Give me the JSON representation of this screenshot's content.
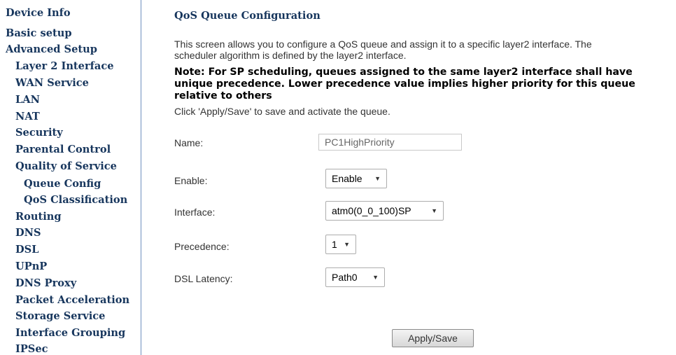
{
  "sidebar": {
    "items": [
      {
        "label": "Device Info"
      },
      {
        "label": "Basic setup"
      },
      {
        "label": "Advanced Setup"
      },
      {
        "label": "Layer 2 Interface"
      },
      {
        "label": "WAN Service"
      },
      {
        "label": "LAN"
      },
      {
        "label": "NAT"
      },
      {
        "label": "Security"
      },
      {
        "label": "Parental Control"
      },
      {
        "label": "Quality of Service"
      },
      {
        "label": "Queue Config"
      },
      {
        "label": "QoS Classification"
      },
      {
        "label": "Routing"
      },
      {
        "label": "DNS"
      },
      {
        "label": "DSL"
      },
      {
        "label": "UPnP"
      },
      {
        "label": "DNS Proxy"
      },
      {
        "label": "Packet Acceleration"
      },
      {
        "label": "Storage Service"
      },
      {
        "label": "Interface Grouping"
      },
      {
        "label": "IPSec"
      }
    ]
  },
  "main": {
    "title": "QoS Queue Configuration",
    "description_line1": "This screen allows you to configure a QoS queue and assign it to a specific layer2 interface. The",
    "description_line2": "scheduler algorithm is defined by the layer2 interface.",
    "note": "Note: For SP scheduling, queues assigned to the same layer2 interface shall have unique precedence. Lower precedence value implies higher priority for this queue relative to others",
    "click_text": "Click 'Apply/Save' to save and activate the queue."
  },
  "form": {
    "name_label": "Name:",
    "name_value": "PC1HighPriority",
    "enable_label": "Enable:",
    "enable_value": "Enable",
    "interface_label": "Interface:",
    "interface_value": "atm0(0_0_100)SP",
    "precedence_label": "Precedence:",
    "precedence_value": "1",
    "latency_label": "DSL Latency:",
    "latency_value": "Path0"
  },
  "buttons": {
    "apply_save": "Apply/Save"
  },
  "icons": {
    "dropdown": "chevron-down-icon"
  },
  "colors": {
    "nav_text": "#17365d",
    "sidebar_border": "#6f8fbf"
  }
}
